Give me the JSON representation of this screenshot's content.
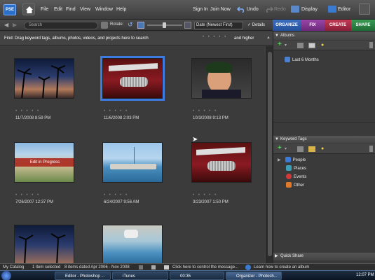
{
  "app": {
    "logo_text": "PSE"
  },
  "menu": [
    "File",
    "Edit",
    "Find",
    "View",
    "Window",
    "Help"
  ],
  "top_right": {
    "sign_in": "Sign In",
    "join_now": "Join Now",
    "undo": "Undo",
    "redo": "Redo",
    "display": "Display",
    "editor": "Editor"
  },
  "toolbar": {
    "search_placeholder": "Search",
    "rotate_label": "Rotate:",
    "sort_value": "Date (Newest First)",
    "details_label": "Details"
  },
  "findbar": {
    "text": "Find: Drag keyword tags, albums, photos, videos, and projects here to search",
    "higher_label": "and higher"
  },
  "photos": [
    {
      "date": "11/7/2008 8:59 PM",
      "stars": "• • • • •"
    },
    {
      "date": "11/6/2008 2:03 PM",
      "stars": "• • • • •"
    },
    {
      "date": "10/3/2008 9:13 PM",
      "stars": "• • • • •"
    },
    {
      "date": "7/26/2007 12:37 PM",
      "stars": "• • • • •",
      "overlay": "Edit in Progress"
    },
    {
      "date": "6/24/2007 9:56 AM",
      "stars": "• • • • •"
    },
    {
      "date": "3/23/2007 1:50 PM",
      "stars": "• • • • •"
    }
  ],
  "tabs": [
    "ORGANIZE",
    "FIX",
    "CREATE",
    "SHARE"
  ],
  "albums": {
    "title": "Albums",
    "items": [
      "Last 6 Months"
    ]
  },
  "keyword_tags": {
    "title": "Keyword Tags",
    "items": [
      "People",
      "Places",
      "Events",
      "Other"
    ]
  },
  "quick_share": {
    "title": "Quick Share"
  },
  "status": {
    "catalog": "My Catalog",
    "selected": "1 item selected",
    "range": "8 items dated Apr 2006 - Nov 2008",
    "message": "Click here to control the message...",
    "learn": "Learn how to create an album"
  },
  "taskbar": {
    "items": [
      "Editor - Photoshop ...",
      "iTunes",
      "00:35",
      "Organizer - Photosh..."
    ],
    "clock": "12:07 PM"
  }
}
